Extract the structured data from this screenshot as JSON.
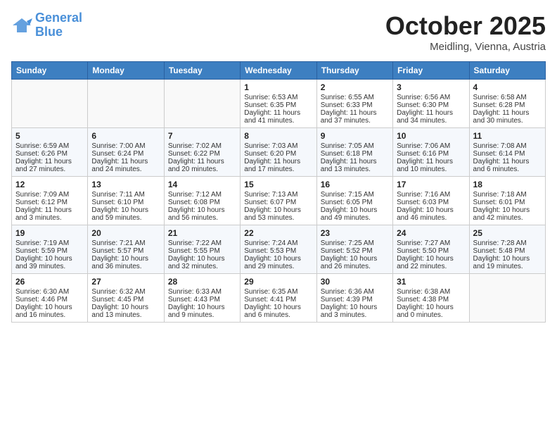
{
  "header": {
    "logo_line1": "General",
    "logo_line2": "Blue",
    "month_title": "October 2025",
    "location": "Meidling, Vienna, Austria"
  },
  "days_of_week": [
    "Sunday",
    "Monday",
    "Tuesday",
    "Wednesday",
    "Thursday",
    "Friday",
    "Saturday"
  ],
  "weeks": [
    [
      {
        "day": "",
        "lines": []
      },
      {
        "day": "",
        "lines": []
      },
      {
        "day": "",
        "lines": []
      },
      {
        "day": "1",
        "lines": [
          "Sunrise: 6:53 AM",
          "Sunset: 6:35 PM",
          "Daylight: 11 hours",
          "and 41 minutes."
        ]
      },
      {
        "day": "2",
        "lines": [
          "Sunrise: 6:55 AM",
          "Sunset: 6:33 PM",
          "Daylight: 11 hours",
          "and 37 minutes."
        ]
      },
      {
        "day": "3",
        "lines": [
          "Sunrise: 6:56 AM",
          "Sunset: 6:30 PM",
          "Daylight: 11 hours",
          "and 34 minutes."
        ]
      },
      {
        "day": "4",
        "lines": [
          "Sunrise: 6:58 AM",
          "Sunset: 6:28 PM",
          "Daylight: 11 hours",
          "and 30 minutes."
        ]
      }
    ],
    [
      {
        "day": "5",
        "lines": [
          "Sunrise: 6:59 AM",
          "Sunset: 6:26 PM",
          "Daylight: 11 hours",
          "and 27 minutes."
        ]
      },
      {
        "day": "6",
        "lines": [
          "Sunrise: 7:00 AM",
          "Sunset: 6:24 PM",
          "Daylight: 11 hours",
          "and 24 minutes."
        ]
      },
      {
        "day": "7",
        "lines": [
          "Sunrise: 7:02 AM",
          "Sunset: 6:22 PM",
          "Daylight: 11 hours",
          "and 20 minutes."
        ]
      },
      {
        "day": "8",
        "lines": [
          "Sunrise: 7:03 AM",
          "Sunset: 6:20 PM",
          "Daylight: 11 hours",
          "and 17 minutes."
        ]
      },
      {
        "day": "9",
        "lines": [
          "Sunrise: 7:05 AM",
          "Sunset: 6:18 PM",
          "Daylight: 11 hours",
          "and 13 minutes."
        ]
      },
      {
        "day": "10",
        "lines": [
          "Sunrise: 7:06 AM",
          "Sunset: 6:16 PM",
          "Daylight: 11 hours",
          "and 10 minutes."
        ]
      },
      {
        "day": "11",
        "lines": [
          "Sunrise: 7:08 AM",
          "Sunset: 6:14 PM",
          "Daylight: 11 hours",
          "and 6 minutes."
        ]
      }
    ],
    [
      {
        "day": "12",
        "lines": [
          "Sunrise: 7:09 AM",
          "Sunset: 6:12 PM",
          "Daylight: 11 hours",
          "and 3 minutes."
        ]
      },
      {
        "day": "13",
        "lines": [
          "Sunrise: 7:11 AM",
          "Sunset: 6:10 PM",
          "Daylight: 10 hours",
          "and 59 minutes."
        ]
      },
      {
        "day": "14",
        "lines": [
          "Sunrise: 7:12 AM",
          "Sunset: 6:08 PM",
          "Daylight: 10 hours",
          "and 56 minutes."
        ]
      },
      {
        "day": "15",
        "lines": [
          "Sunrise: 7:13 AM",
          "Sunset: 6:07 PM",
          "Daylight: 10 hours",
          "and 53 minutes."
        ]
      },
      {
        "day": "16",
        "lines": [
          "Sunrise: 7:15 AM",
          "Sunset: 6:05 PM",
          "Daylight: 10 hours",
          "and 49 minutes."
        ]
      },
      {
        "day": "17",
        "lines": [
          "Sunrise: 7:16 AM",
          "Sunset: 6:03 PM",
          "Daylight: 10 hours",
          "and 46 minutes."
        ]
      },
      {
        "day": "18",
        "lines": [
          "Sunrise: 7:18 AM",
          "Sunset: 6:01 PM",
          "Daylight: 10 hours",
          "and 42 minutes."
        ]
      }
    ],
    [
      {
        "day": "19",
        "lines": [
          "Sunrise: 7:19 AM",
          "Sunset: 5:59 PM",
          "Daylight: 10 hours",
          "and 39 minutes."
        ]
      },
      {
        "day": "20",
        "lines": [
          "Sunrise: 7:21 AM",
          "Sunset: 5:57 PM",
          "Daylight: 10 hours",
          "and 36 minutes."
        ]
      },
      {
        "day": "21",
        "lines": [
          "Sunrise: 7:22 AM",
          "Sunset: 5:55 PM",
          "Daylight: 10 hours",
          "and 32 minutes."
        ]
      },
      {
        "day": "22",
        "lines": [
          "Sunrise: 7:24 AM",
          "Sunset: 5:53 PM",
          "Daylight: 10 hours",
          "and 29 minutes."
        ]
      },
      {
        "day": "23",
        "lines": [
          "Sunrise: 7:25 AM",
          "Sunset: 5:52 PM",
          "Daylight: 10 hours",
          "and 26 minutes."
        ]
      },
      {
        "day": "24",
        "lines": [
          "Sunrise: 7:27 AM",
          "Sunset: 5:50 PM",
          "Daylight: 10 hours",
          "and 22 minutes."
        ]
      },
      {
        "day": "25",
        "lines": [
          "Sunrise: 7:28 AM",
          "Sunset: 5:48 PM",
          "Daylight: 10 hours",
          "and 19 minutes."
        ]
      }
    ],
    [
      {
        "day": "26",
        "lines": [
          "Sunrise: 6:30 AM",
          "Sunset: 4:46 PM",
          "Daylight: 10 hours",
          "and 16 minutes."
        ]
      },
      {
        "day": "27",
        "lines": [
          "Sunrise: 6:32 AM",
          "Sunset: 4:45 PM",
          "Daylight: 10 hours",
          "and 13 minutes."
        ]
      },
      {
        "day": "28",
        "lines": [
          "Sunrise: 6:33 AM",
          "Sunset: 4:43 PM",
          "Daylight: 10 hours",
          "and 9 minutes."
        ]
      },
      {
        "day": "29",
        "lines": [
          "Sunrise: 6:35 AM",
          "Sunset: 4:41 PM",
          "Daylight: 10 hours",
          "and 6 minutes."
        ]
      },
      {
        "day": "30",
        "lines": [
          "Sunrise: 6:36 AM",
          "Sunset: 4:39 PM",
          "Daylight: 10 hours",
          "and 3 minutes."
        ]
      },
      {
        "day": "31",
        "lines": [
          "Sunrise: 6:38 AM",
          "Sunset: 4:38 PM",
          "Daylight: 10 hours",
          "and 0 minutes."
        ]
      },
      {
        "day": "",
        "lines": []
      }
    ]
  ]
}
